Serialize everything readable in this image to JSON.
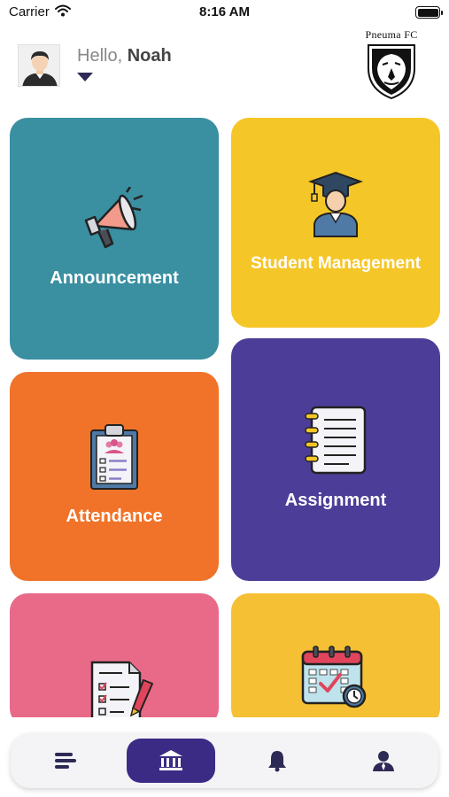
{
  "status_bar": {
    "carrier": "Carrier",
    "time": "8:16 AM"
  },
  "header": {
    "greeting_prefix": "Hello, ",
    "user_name": "Noah",
    "club_name": "Pneuma FC"
  },
  "tiles": [
    {
      "label": "Announcement",
      "color": "#3a8fa1",
      "icon": "megaphone-icon"
    },
    {
      "label": "Student Management",
      "color": "#f5c627",
      "icon": "graduate-icon"
    },
    {
      "label": "Attendance",
      "color": "#f07329",
      "icon": "clipboard-icon"
    },
    {
      "label": "Assignment",
      "color": "#4c3e98",
      "icon": "notebook-icon"
    },
    {
      "label": "",
      "color": "#e96a88",
      "icon": "document-pen-icon"
    },
    {
      "label": "",
      "color": "#f5c033",
      "icon": "calendar-icon"
    }
  ],
  "bottom_nav": {
    "items": [
      {
        "icon": "menu-icon",
        "active": false
      },
      {
        "icon": "bank-icon",
        "active": true
      },
      {
        "icon": "bell-icon",
        "active": false
      },
      {
        "icon": "profile-icon",
        "active": false
      }
    ],
    "active_color": "#3b2b85"
  }
}
